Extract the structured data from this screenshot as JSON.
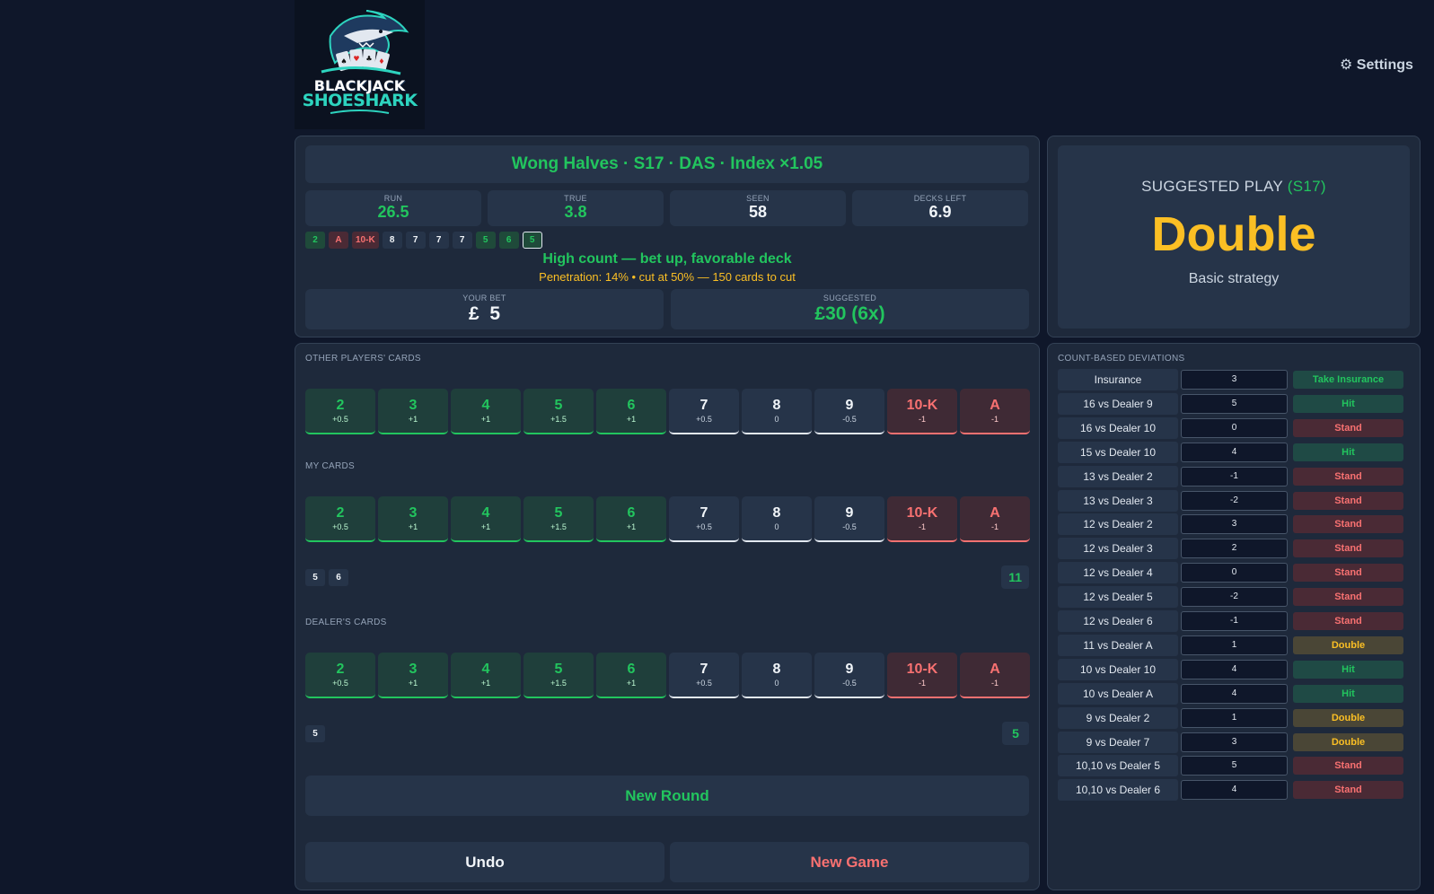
{
  "logo": {
    "line1": "BLACKJACK",
    "line2": "SHOESHARK"
  },
  "settings": {
    "icon": "gear-icon",
    "label": "⚙ Settings"
  },
  "system": {
    "title": "Wong Halves · S17 · DAS · Index ×1.05"
  },
  "stats": [
    {
      "label": "RUN",
      "value": "26.5",
      "color": "#22c55e"
    },
    {
      "label": "TRUE",
      "value": "3.8",
      "color": "#22c55e"
    },
    {
      "label": "SEEN",
      "value": "58",
      "color": "#f1f5f9"
    },
    {
      "label": "DECKS LEFT",
      "value": "6.9",
      "color": "#f1f5f9"
    }
  ],
  "history": [
    "2",
    "A",
    "10-K",
    "8",
    "7",
    "7",
    "7",
    "5",
    "6",
    "5"
  ],
  "message": "High count — bet up, favorable deck",
  "penetration": "Penetration: 14% • cut at 50% — 150 cards to cut",
  "bet": {
    "your_label": "YOUR BET",
    "your_value": "£  5",
    "suggested_label": "SUGGESTED",
    "suggested_value": "£30 (6x)"
  },
  "suggestion": {
    "label": "SUGGESTED PLAY",
    "rule": "(S17)",
    "action": "Double",
    "source": "Basic strategy"
  },
  "cards": [
    {
      "rank": "2",
      "weight": "+0.5"
    },
    {
      "rank": "3",
      "weight": "+1"
    },
    {
      "rank": "4",
      "weight": "+1"
    },
    {
      "rank": "5",
      "weight": "+1.5"
    },
    {
      "rank": "6",
      "weight": "+1"
    },
    {
      "rank": "7",
      "weight": "+0.5"
    },
    {
      "rank": "8",
      "weight": "0"
    },
    {
      "rank": "9",
      "weight": "-0.5"
    },
    {
      "rank": "10-K",
      "weight": "-1"
    },
    {
      "rank": "A",
      "weight": "-1"
    }
  ],
  "sections": {
    "others": "OTHER PLAYERS' CARDS",
    "mine": "MY CARDS",
    "dealer": "DEALER'S CARDS"
  },
  "my_hand": {
    "cards": [
      "5",
      "6"
    ],
    "total": "11"
  },
  "dealer_hand": {
    "cards": [
      "5"
    ],
    "total": "5"
  },
  "buttons": {
    "new_round": "New Round",
    "undo": "Undo",
    "new_game": "New Game"
  },
  "deviations": {
    "title": "COUNT-BASED DEVIATIONS",
    "rows": [
      {
        "hand": "Insurance",
        "index": "3",
        "action": "Take Insurance",
        "type": "hit"
      },
      {
        "hand": "16 vs Dealer 9",
        "index": "5",
        "action": "Hit",
        "type": "hit"
      },
      {
        "hand": "16 vs Dealer 10",
        "index": "0",
        "action": "Stand",
        "type": "stand"
      },
      {
        "hand": "15 vs Dealer 10",
        "index": "4",
        "action": "Hit",
        "type": "hit"
      },
      {
        "hand": "13 vs Dealer 2",
        "index": "-1",
        "action": "Stand",
        "type": "stand"
      },
      {
        "hand": "13 vs Dealer 3",
        "index": "-2",
        "action": "Stand",
        "type": "stand"
      },
      {
        "hand": "12 vs Dealer 2",
        "index": "3",
        "action": "Stand",
        "type": "stand"
      },
      {
        "hand": "12 vs Dealer 3",
        "index": "2",
        "action": "Stand",
        "type": "stand"
      },
      {
        "hand": "12 vs Dealer 4",
        "index": "0",
        "action": "Stand",
        "type": "stand"
      },
      {
        "hand": "12 vs Dealer 5",
        "index": "-2",
        "action": "Stand",
        "type": "stand"
      },
      {
        "hand": "12 vs Dealer 6",
        "index": "-1",
        "action": "Stand",
        "type": "stand"
      },
      {
        "hand": "11 vs Dealer A",
        "index": "1",
        "action": "Double",
        "type": "double"
      },
      {
        "hand": "10 vs Dealer 10",
        "index": "4",
        "action": "Hit",
        "type": "hit"
      },
      {
        "hand": "10 vs Dealer A",
        "index": "4",
        "action": "Hit",
        "type": "hit"
      },
      {
        "hand": "9 vs Dealer 2",
        "index": "1",
        "action": "Double",
        "type": "double"
      },
      {
        "hand": "9 vs Dealer 7",
        "index": "3",
        "action": "Double",
        "type": "double"
      },
      {
        "hand": "10,10 vs Dealer 5",
        "index": "5",
        "action": "Stand",
        "type": "stand"
      },
      {
        "hand": "10,10 vs Dealer 6",
        "index": "4",
        "action": "Stand",
        "type": "stand"
      }
    ]
  }
}
